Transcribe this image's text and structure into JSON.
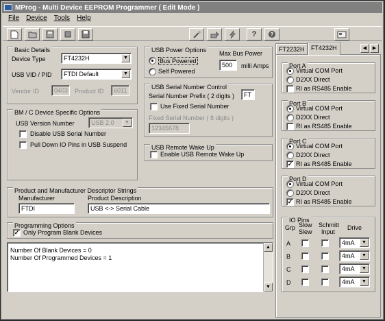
{
  "window": {
    "title": "MProg - Multi Device EEPROM Programmer ( Edit Mode )"
  },
  "menu": [
    "File",
    "Device",
    "Tools",
    "Help"
  ],
  "toolbar_icons": [
    "new-file-icon",
    "open-folder-icon",
    "save-template-icon",
    "stop-icon",
    "save-disk-icon",
    "program-wand-icon",
    "read-device-icon",
    "erase-lightning-icon",
    "help-icon",
    "about-icon",
    "device-tab-icon"
  ],
  "basic": {
    "legend": "Basic Details",
    "device_type_label": "Device Type",
    "device_type_value": "FT4232H",
    "vidpid_label": "USB VID / PID",
    "vidpid_value": "FTDI Default",
    "vendor_id_label": "Vendor ID",
    "vendor_id_value": "0403",
    "product_id_label": "Product ID",
    "product_id_value": "6011"
  },
  "bm": {
    "legend": "BM / C Device Specific Options",
    "usb_version_label": "USB Version Number",
    "usb_version_value": "USB 2.0",
    "disable_serial_label": "Disable USB Serial Number",
    "pulldown_label": "Pull Down IO Pins in USB Suspend"
  },
  "power": {
    "legend": "USB Power Options",
    "bus_powered": "Bus Powered",
    "self_powered": "Self Powered",
    "max_bus_label": "Max Bus Power",
    "max_bus_value": "500",
    "milli_amps": "milli Amps"
  },
  "serial": {
    "legend": "USB Serial Number Control",
    "prefix_label": "Serial Number Prefix ( 2 digits )",
    "prefix_value": "FT",
    "use_fixed_label": "Use Fixed Serial Number",
    "fixed_label": "Fixed Serial Number ( 8 digits )",
    "fixed_value": "12345678"
  },
  "wake": {
    "legend": "USB Remote Wake Up",
    "enable_label": "Enable USB Remote Wake Up"
  },
  "descriptors": {
    "legend": "Product and Manufacturer Descriptor Strings",
    "manufacturer_label": "Manufacturer",
    "manufacturer_value": "FTDI",
    "product_label": "Product Description",
    "product_value": "USB <-> Serial Cable"
  },
  "programming": {
    "legend": "Programming Options",
    "only_blank_label": "Only Program Blank Devices"
  },
  "status_lines": [
    "Number Of Blank Devices = 0",
    "Number Of Programmed Devices = 1"
  ],
  "tabs": [
    "FT2232H",
    "FT4232H"
  ],
  "ports": [
    {
      "legend": "Port A",
      "vcp": "Virtual COM Port",
      "d2xx": "D2XX Direct",
      "ri": "RI as RS485 Enable",
      "ri_checked": ""
    },
    {
      "legend": "Port B",
      "vcp": "Virtual COM Port",
      "d2xx": "D2XX Direct",
      "ri": "RI as RS485 Enable",
      "ri_checked": ""
    },
    {
      "legend": "Port C",
      "vcp": "Virtual COM Port",
      "d2xx": "D2XX Direct",
      "ri": "RI as RS485 Enable",
      "ri_checked": "✓"
    },
    {
      "legend": "Port D",
      "vcp": "Virtual COM Port",
      "d2xx": "D2XX Direct",
      "ri": "RI as RS485 Enable",
      "ri_checked": "✓"
    }
  ],
  "io": {
    "legend": "IO Pins",
    "h_grp": "Grp",
    "h_slow1": "Slow",
    "h_slow2": "Slew",
    "h_schmitt1": "Schmitt",
    "h_schmitt2": "Input",
    "h_drive": "Drive",
    "rows": [
      {
        "grp": "A",
        "drive": "4mA"
      },
      {
        "grp": "B",
        "drive": "4mA"
      },
      {
        "grp": "C",
        "drive": "4mA"
      },
      {
        "grp": "D",
        "drive": "4mA"
      }
    ]
  }
}
